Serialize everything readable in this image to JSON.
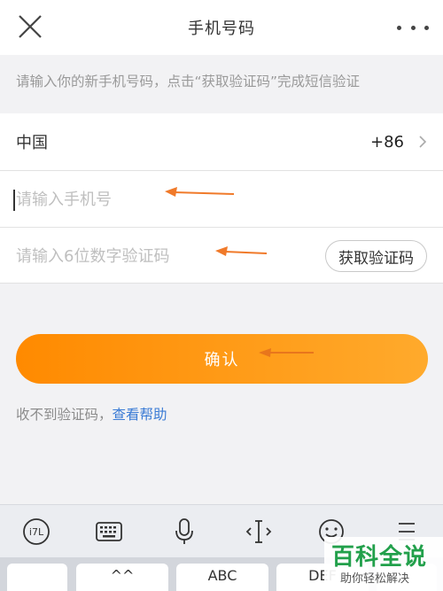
{
  "header": {
    "title": "手机号码"
  },
  "hint": "请输入你的新手机号码，点击“获取验证码”完成短信验证",
  "form": {
    "country_label": "中国",
    "country_code": "+86",
    "phone_placeholder": "请输入手机号",
    "code_placeholder": "请输入6位数字验证码",
    "get_code_label": "获取验证码"
  },
  "confirm_label": "确认",
  "help": {
    "prefix": "收不到验证码，",
    "link": "查看帮助"
  },
  "keyboard": {
    "toolbar_icons": [
      "handwriting-icon",
      "keyboard-icon",
      "microphone-icon",
      "text-cursor-icon",
      "emoji-icon",
      "menu-icon"
    ],
    "keys": [
      "",
      "^^",
      "ABC",
      "DEF",
      ""
    ]
  },
  "watermark": {
    "main": "百科全说",
    "sub": "助你轻松解决"
  },
  "colors": {
    "accent_orange": "#ff8a00",
    "arrow_orange": "#f07a2a",
    "link_blue": "#3a7bd5",
    "watermark_green": "#22a04b"
  }
}
